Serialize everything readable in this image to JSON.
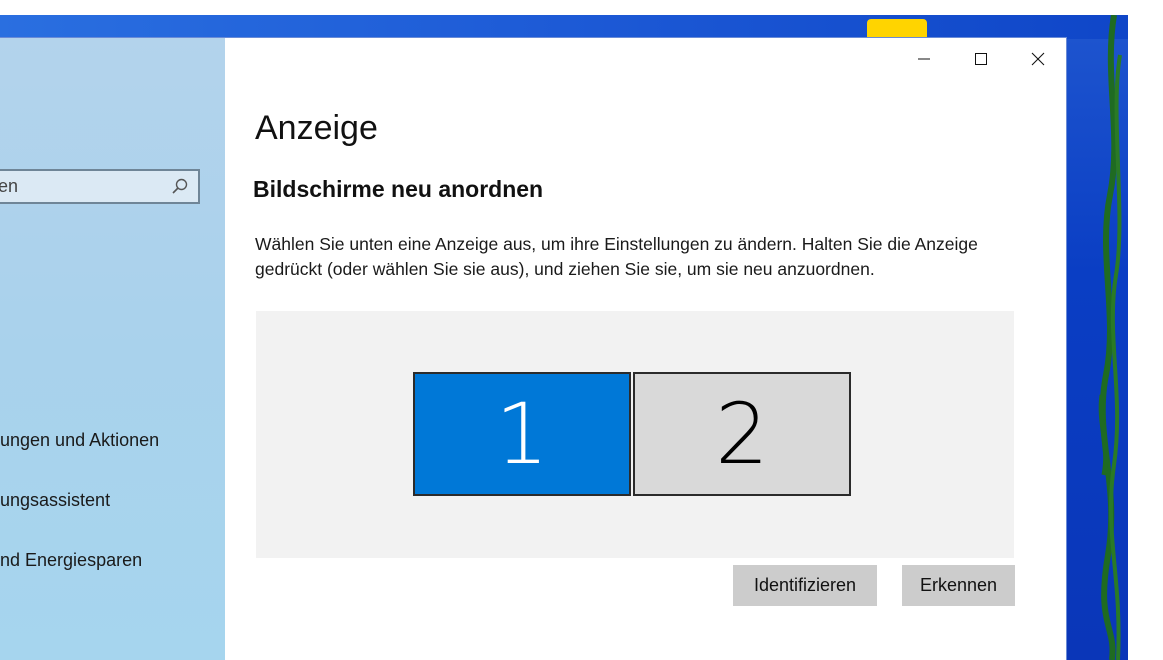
{
  "window": {
    "title": "Anzeige",
    "controls": {
      "minimize_icon": "minimize-icon",
      "maximize_icon": "maximize-icon",
      "close_icon": "close-icon"
    }
  },
  "sidebar": {
    "search": {
      "value": "en",
      "icon": "search-icon"
    },
    "items": [
      {
        "label": "ungen und Aktionen"
      },
      {
        "label": "ungsassistent"
      },
      {
        "label": "nd Energiesparen"
      }
    ]
  },
  "main": {
    "title": "Anzeige",
    "section_title": "Bildschirme neu anordnen",
    "description": "Wählen Sie unten eine Anzeige aus, um ihre Einstellungen zu ändern. Halten Sie die Anzeige gedrückt (oder wählen Sie sie aus), und ziehen Sie sie, um sie neu anzuordnen.",
    "monitors": [
      {
        "label": "1",
        "selected": true
      },
      {
        "label": "2",
        "selected": false
      }
    ],
    "buttons": {
      "identify": "Identifizieren",
      "detect": "Erkennen"
    }
  },
  "colors": {
    "accent": "#0078d7",
    "sidebar_bg": "#aad3ec",
    "panel_bg": "#f2f2f2",
    "button_bg": "#cccccc"
  }
}
